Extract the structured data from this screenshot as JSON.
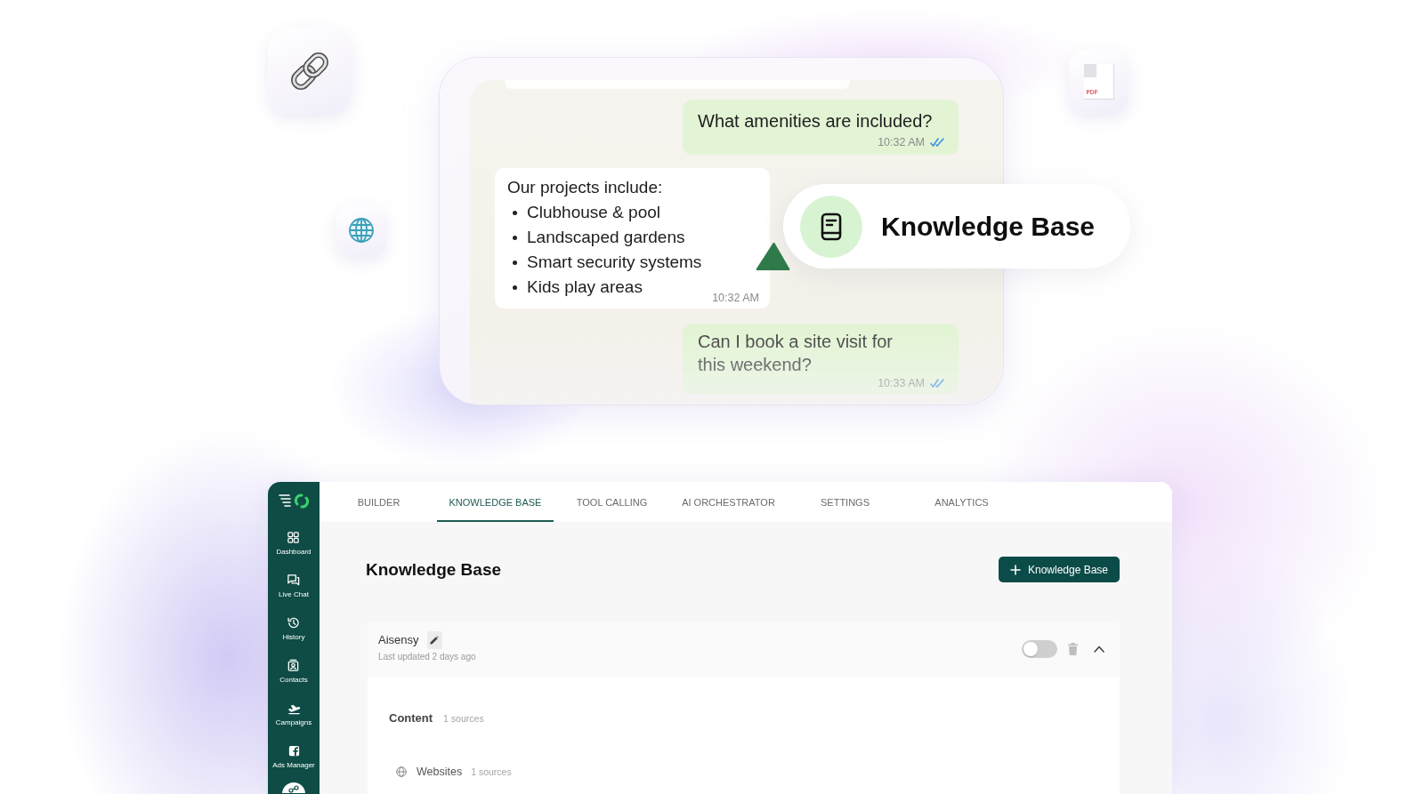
{
  "floating_tiles": {
    "document_label": "PDF"
  },
  "chat": {
    "messages": [
      {
        "kind": "outgoing",
        "text": "What amenities are included?",
        "time": "10:32 AM",
        "read": true
      },
      {
        "kind": "incoming",
        "text": "Our projects include:",
        "items": [
          "Clubhouse & pool",
          "Landscaped gardens",
          "Smart security systems",
          "Kids play areas"
        ],
        "time": "10:32 AM"
      },
      {
        "kind": "outgoing",
        "text": "Can I book a site visit for\nthis weekend?",
        "time": "10:33 AM",
        "read": true
      }
    ]
  },
  "feature_badge": {
    "label": "Knowledge Base"
  },
  "app": {
    "sidebar": {
      "items": [
        {
          "label": "Dashboard"
        },
        {
          "label": "Live Chat"
        },
        {
          "label": "History"
        },
        {
          "label": "Contacts"
        },
        {
          "label": "Campaigns"
        },
        {
          "label": "Ads Manager"
        }
      ]
    },
    "tabs": [
      {
        "label": "BUILDER",
        "selected": false
      },
      {
        "label": "KNOWLEDGE BASE",
        "selected": true
      },
      {
        "label": "TOOL CALLING",
        "selected": false
      },
      {
        "label": "AI ORCHESTRATOR",
        "selected": false
      },
      {
        "label": "SETTINGS",
        "selected": false
      },
      {
        "label": "ANALYTICS",
        "selected": false
      }
    ],
    "page_title": "Knowledge Base",
    "add_button": {
      "label": "Knowledge Base"
    },
    "knowledge_bases": [
      {
        "name": "Aisensy",
        "updated": "Last updated 2 days ago",
        "enabled": false,
        "expanded": true,
        "content": {
          "label": "Content",
          "count": "1 sources",
          "sources": [
            {
              "label": "Websites",
              "count": "1 sources"
            }
          ]
        }
      }
    ]
  }
}
